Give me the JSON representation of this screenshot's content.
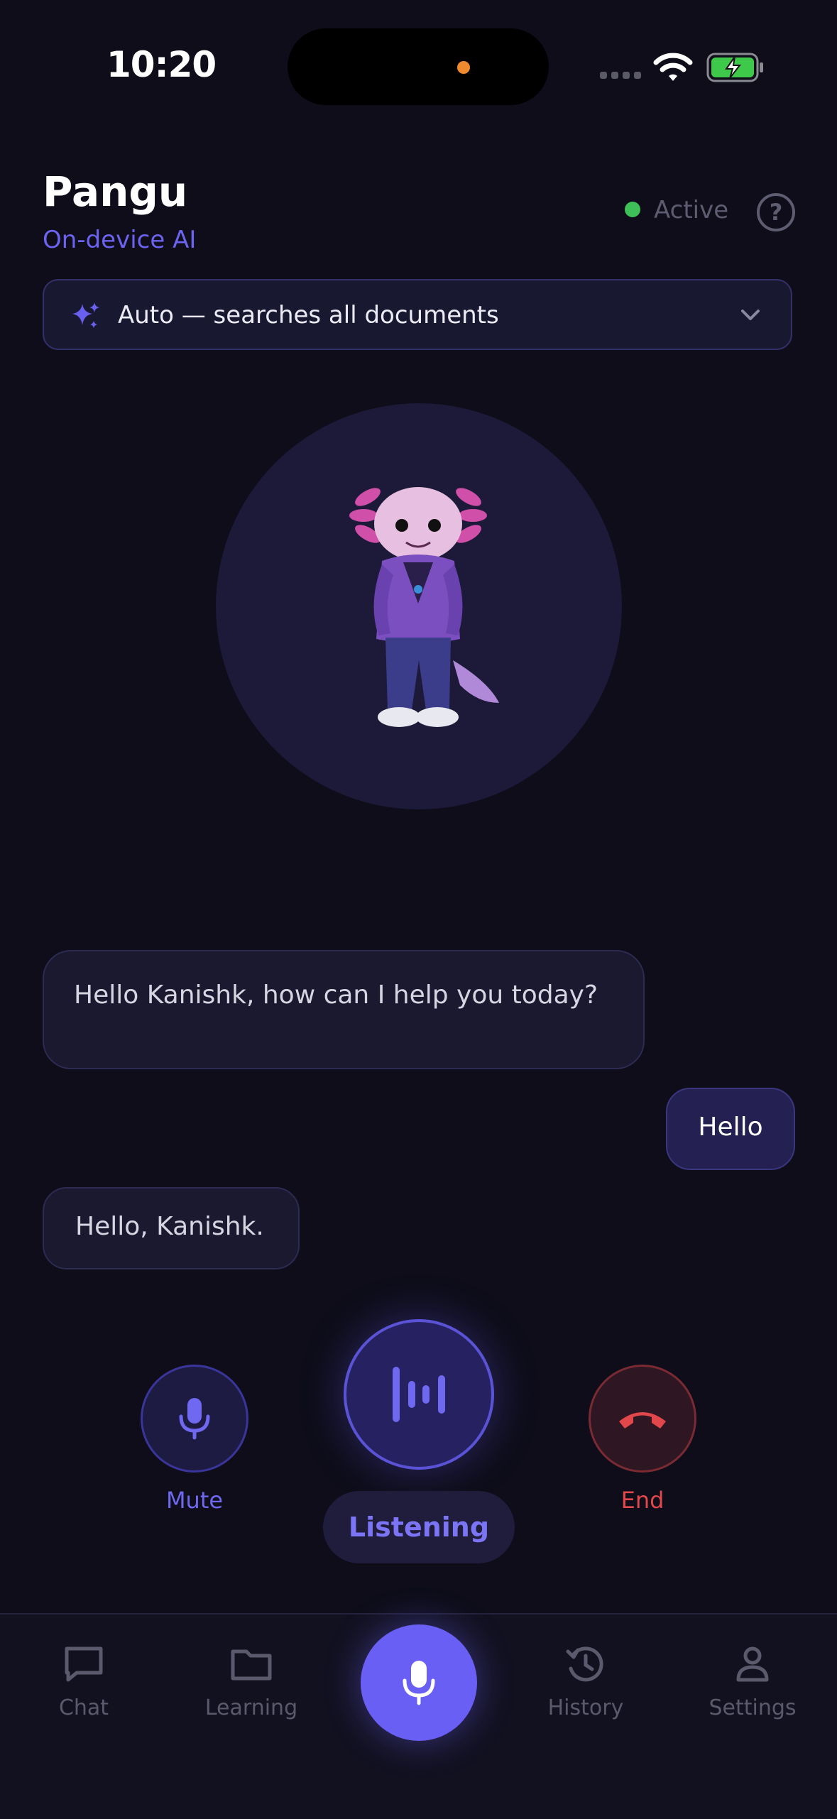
{
  "status_bar": {
    "time": "10:20"
  },
  "header": {
    "title": "Pangu",
    "subtitle": "On-device AI",
    "status_label": "Active",
    "status_color": "#3fbf57",
    "help_icon": "question-circle-icon"
  },
  "document_selector": {
    "icon": "sparkle-icon",
    "label": "Auto — searches all documents"
  },
  "avatar": {
    "description_icon": "axolotl-mascot"
  },
  "messages": [
    {
      "role": "assistant",
      "text": "Hello Kanishk, how can I help you today?"
    },
    {
      "role": "user",
      "text": "Hello"
    },
    {
      "role": "assistant",
      "text": "Hello, Kanishk."
    }
  ],
  "call_controls": {
    "mute_label": "Mute",
    "listening_label": "Listening",
    "end_label": "End",
    "accent_color": "#6f68f0",
    "end_color": "#e2474b"
  },
  "bottom_nav": {
    "items": [
      {
        "label": "Chat",
        "icon": "chat-bubble-icon"
      },
      {
        "label": "Learning",
        "icon": "folder-icon"
      },
      {
        "label": "",
        "icon": "microphone-icon"
      },
      {
        "label": "History",
        "icon": "history-icon"
      },
      {
        "label": "Settings",
        "icon": "person-icon"
      }
    ]
  }
}
